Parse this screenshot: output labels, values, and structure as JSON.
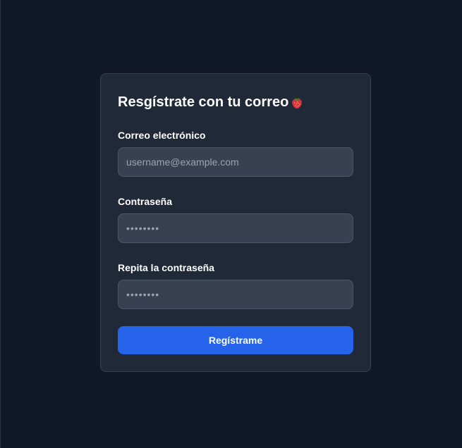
{
  "form": {
    "title": "Resgístrate con tu correo",
    "title_icon": "strawberry-icon",
    "email": {
      "label": "Correo electrónico",
      "placeholder": "username@example.com",
      "value": ""
    },
    "password": {
      "label": "Contraseña",
      "placeholder": "••••••••",
      "value": ""
    },
    "password_repeat": {
      "label": "Repita la contraseña",
      "placeholder": "••••••••",
      "value": ""
    },
    "submit_label": "Regístrame"
  },
  "colors": {
    "page_background": "#111827",
    "card_background": "#1f2937",
    "input_background": "#374151",
    "accent": "#2563eb"
  }
}
